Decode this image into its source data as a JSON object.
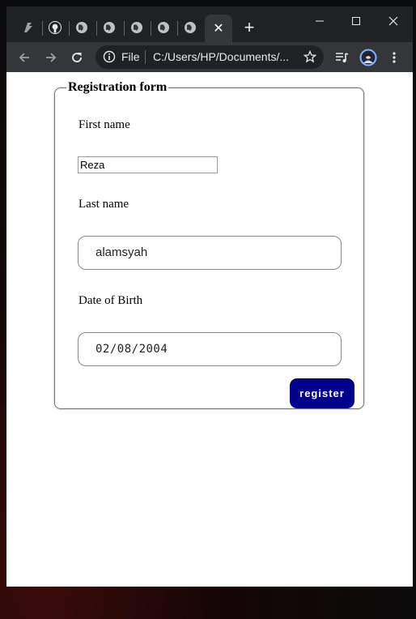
{
  "browser": {
    "tabs": [
      {
        "icon": "app-favicon-icon"
      },
      {
        "icon": "github-favicon-icon"
      },
      {
        "icon": "globe-favicon-icon"
      },
      {
        "icon": "globe-favicon-icon"
      },
      {
        "icon": "globe-favicon-icon"
      },
      {
        "icon": "globe-favicon-icon"
      },
      {
        "icon": "globe-favicon-icon"
      }
    ],
    "active_tab_close": "✕",
    "new_tab": "+",
    "window_controls": {
      "minimize": "–",
      "maximize": "☐",
      "close": "✕"
    },
    "omnibox": {
      "scheme_label": "File",
      "url": "C:/Users/HP/Documents/..."
    },
    "colors": {
      "titlebar": "#202124",
      "toolbar": "#35363a",
      "omnibox": "#202124"
    }
  },
  "form": {
    "legend": "Registration form",
    "first_name": {
      "label": "First name",
      "value": "Reza"
    },
    "last_name": {
      "label": "Last name",
      "value": "alamsyah"
    },
    "dob": {
      "label": "Date of Birth",
      "value": "02/08/2004"
    },
    "submit_label": "register",
    "colors": {
      "submit_bg": "#00008b",
      "submit_text": "#ffffff"
    }
  }
}
